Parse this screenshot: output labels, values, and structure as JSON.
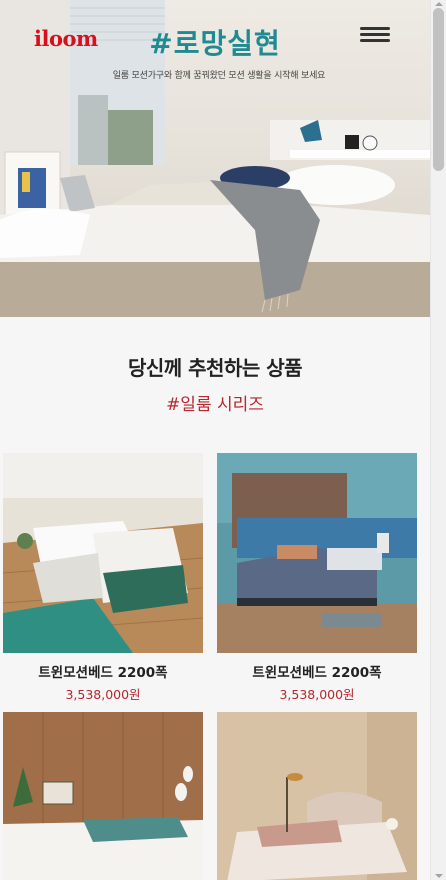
{
  "header": {
    "logo": "iloom",
    "title": "#로망실현",
    "subtitle": "일룸 모션가구와 함께 꿈꿔왔던 모션 생활을 시작해 보세요",
    "menu_icon": "hamburger-menu-icon"
  },
  "section": {
    "title": "당신께 추천하는 상품",
    "subtitle": "#일룸 시리즈"
  },
  "products": [
    {
      "name": "트윈모션베드 2200폭",
      "price": "3,538,000원"
    },
    {
      "name": "트윈모션베드 2200폭",
      "price": "3,538,000원"
    },
    {
      "name": "",
      "price": ""
    },
    {
      "name": "",
      "price": ""
    }
  ],
  "colors": {
    "brand_red": "#d6101c",
    "title_teal": "#1f8a92",
    "price_red": "#b8262e"
  }
}
